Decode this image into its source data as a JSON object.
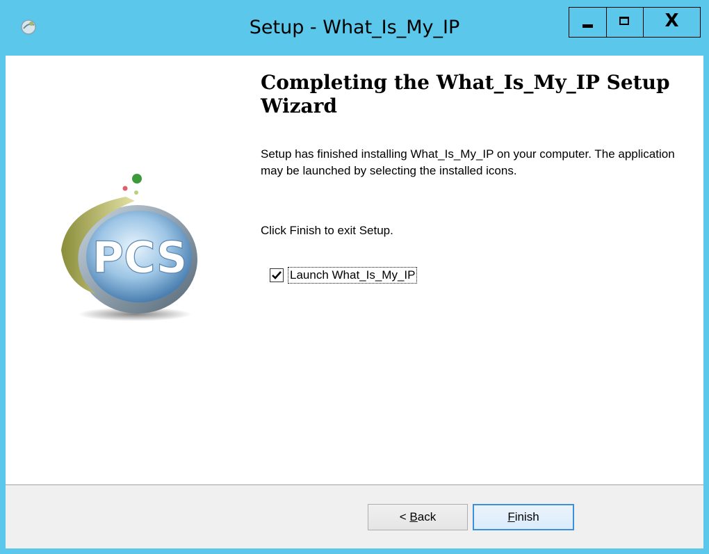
{
  "window": {
    "title": "Setup - What_Is_My_IP",
    "buttons": {
      "minimize": "minimize",
      "maximize": "maximize",
      "close": "X"
    }
  },
  "logo": {
    "text": "PCS"
  },
  "wizard": {
    "heading": "Completing the What_Is_My_IP Setup Wizard",
    "body": "Setup has finished installing What_Is_My_IP on your computer. The application may be launched by selecting the installed icons.",
    "instruction": "Click Finish to exit Setup.",
    "launch_checkbox": {
      "label": "Launch What_Is_My_IP",
      "checked": true
    }
  },
  "footer": {
    "back_prefix": "< ",
    "back_mnemonic": "B",
    "back_rest": "ack",
    "finish_mnemonic": "F",
    "finish_rest": "inish"
  },
  "colors": {
    "frame": "#5bc7ea",
    "client": "#ffffff",
    "footer": "#f0f0f0",
    "default_button_border": "#3c8fd8"
  }
}
